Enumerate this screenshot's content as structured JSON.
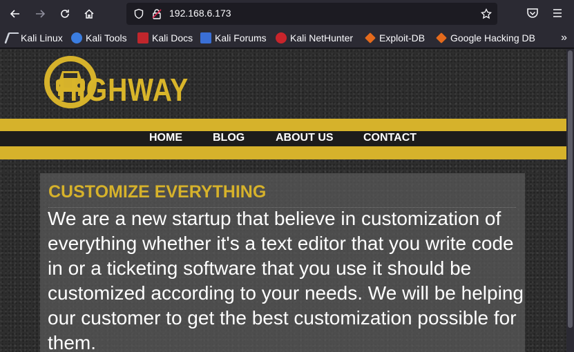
{
  "browser": {
    "url": "192.168.6.173",
    "bookmarks": [
      {
        "label": "Kali Linux",
        "icon": "kali-dragon-icon"
      },
      {
        "label": "Kali Tools",
        "icon": "kali-tools-icon"
      },
      {
        "label": "Kali Docs",
        "icon": "kali-docs-icon"
      },
      {
        "label": "Kali Forums",
        "icon": "kali-forums-icon"
      },
      {
        "label": "Kali NetHunter",
        "icon": "kali-nethunter-icon"
      },
      {
        "label": "Exploit-DB",
        "icon": "exploit-db-icon"
      },
      {
        "label": "Google Hacking DB",
        "icon": "ghdb-icon"
      }
    ],
    "more_glyph": "»"
  },
  "site": {
    "logo_text": "HIGHWAY",
    "nav": [
      "HOME",
      "BLOG",
      "ABOUT US",
      "CONTACT"
    ],
    "heading": "CUSTOMIZE EVERYTHING",
    "body": "We are a new startup that believe in customization of everything whether it's a text editor that you write code in or a ticketing software that you use it should be customized according to your needs. We will be helping our customer to get the best customization possible for them."
  },
  "colors": {
    "accent": "#d6b22b",
    "chrome": "#2b2a33",
    "urlbar": "#1c1b22"
  }
}
